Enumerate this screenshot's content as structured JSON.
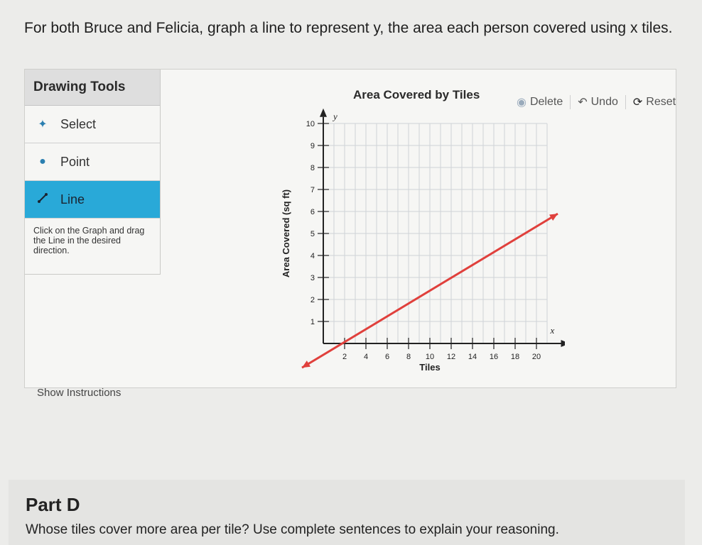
{
  "prompt": {
    "text": "For both Bruce and Felicia, graph a line to represent y, the area each person covered using x tiles."
  },
  "drawing_tools": {
    "title": "Drawing Tools",
    "items": [
      {
        "label": "Select",
        "icon": "select-icon"
      },
      {
        "label": "Point",
        "icon": "point-icon"
      },
      {
        "label": "Line",
        "icon": "line-icon",
        "active": true
      }
    ],
    "note": "Click on the Graph and drag the Line in the desired direction."
  },
  "graph": {
    "title": "Area Covered by Tiles",
    "actions": {
      "delete": "Delete",
      "undo": "Undo",
      "reset": "Reset"
    },
    "y_label": "Area Covered (sq ft)",
    "x_label": "Tiles",
    "x_axis_letter": "x",
    "y_axis_letter": "y",
    "x_ticks": [
      "2",
      "4",
      "6",
      "8",
      "10",
      "12",
      "14",
      "16",
      "18",
      "20"
    ],
    "y_ticks": [
      "1",
      "2",
      "3",
      "4",
      "5",
      "6",
      "7",
      "8",
      "9",
      "10"
    ],
    "x_range": [
      0,
      22
    ],
    "y_range": [
      0,
      10
    ],
    "line": {
      "from": [
        -2,
        -1.1
      ],
      "to": [
        22,
        5.9
      ],
      "color": "#e0403c"
    }
  },
  "show_instructions": "Show Instructions",
  "part_d": {
    "title": "Part D",
    "question": "Whose tiles cover more area per tile? Use complete sentences to explain your reasoning."
  }
}
